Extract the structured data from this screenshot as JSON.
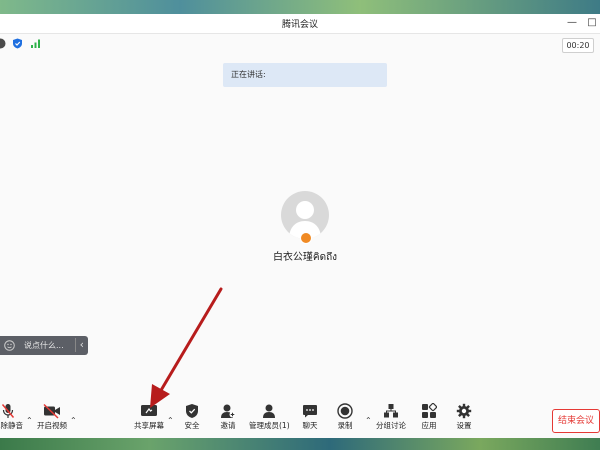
{
  "window": {
    "title": "腾讯会议"
  },
  "status": {
    "timer": "00:20"
  },
  "speaking": {
    "label": "正在讲话:"
  },
  "participant": {
    "name": "白衣公瑾คิดถึง"
  },
  "chat": {
    "placeholder": "说点什么..."
  },
  "toolbar": {
    "mute_label": "解除静音",
    "video_label": "开启视频",
    "share_label": "共享屏幕",
    "security_label": "安全",
    "invite_label": "邀请",
    "members_label": "管理成员(1)",
    "chat_label": "聊天",
    "record_label": "录制",
    "breakout_label": "分组讨论",
    "apps_label": "应用",
    "settings_label": "设置",
    "end_label": "结束会议"
  },
  "colors": {
    "end_red": "#e53935",
    "arrow_red": "#b71c1c",
    "speaking_bg": "#dde8f6"
  },
  "icons": [
    "shield-icon",
    "signal-icon",
    "mic-muted-icon",
    "video-off-icon",
    "share-screen-icon",
    "security-icon",
    "invite-icon",
    "members-icon",
    "chat-icon",
    "record-icon",
    "breakout-icon",
    "apps-icon",
    "settings-icon"
  ]
}
